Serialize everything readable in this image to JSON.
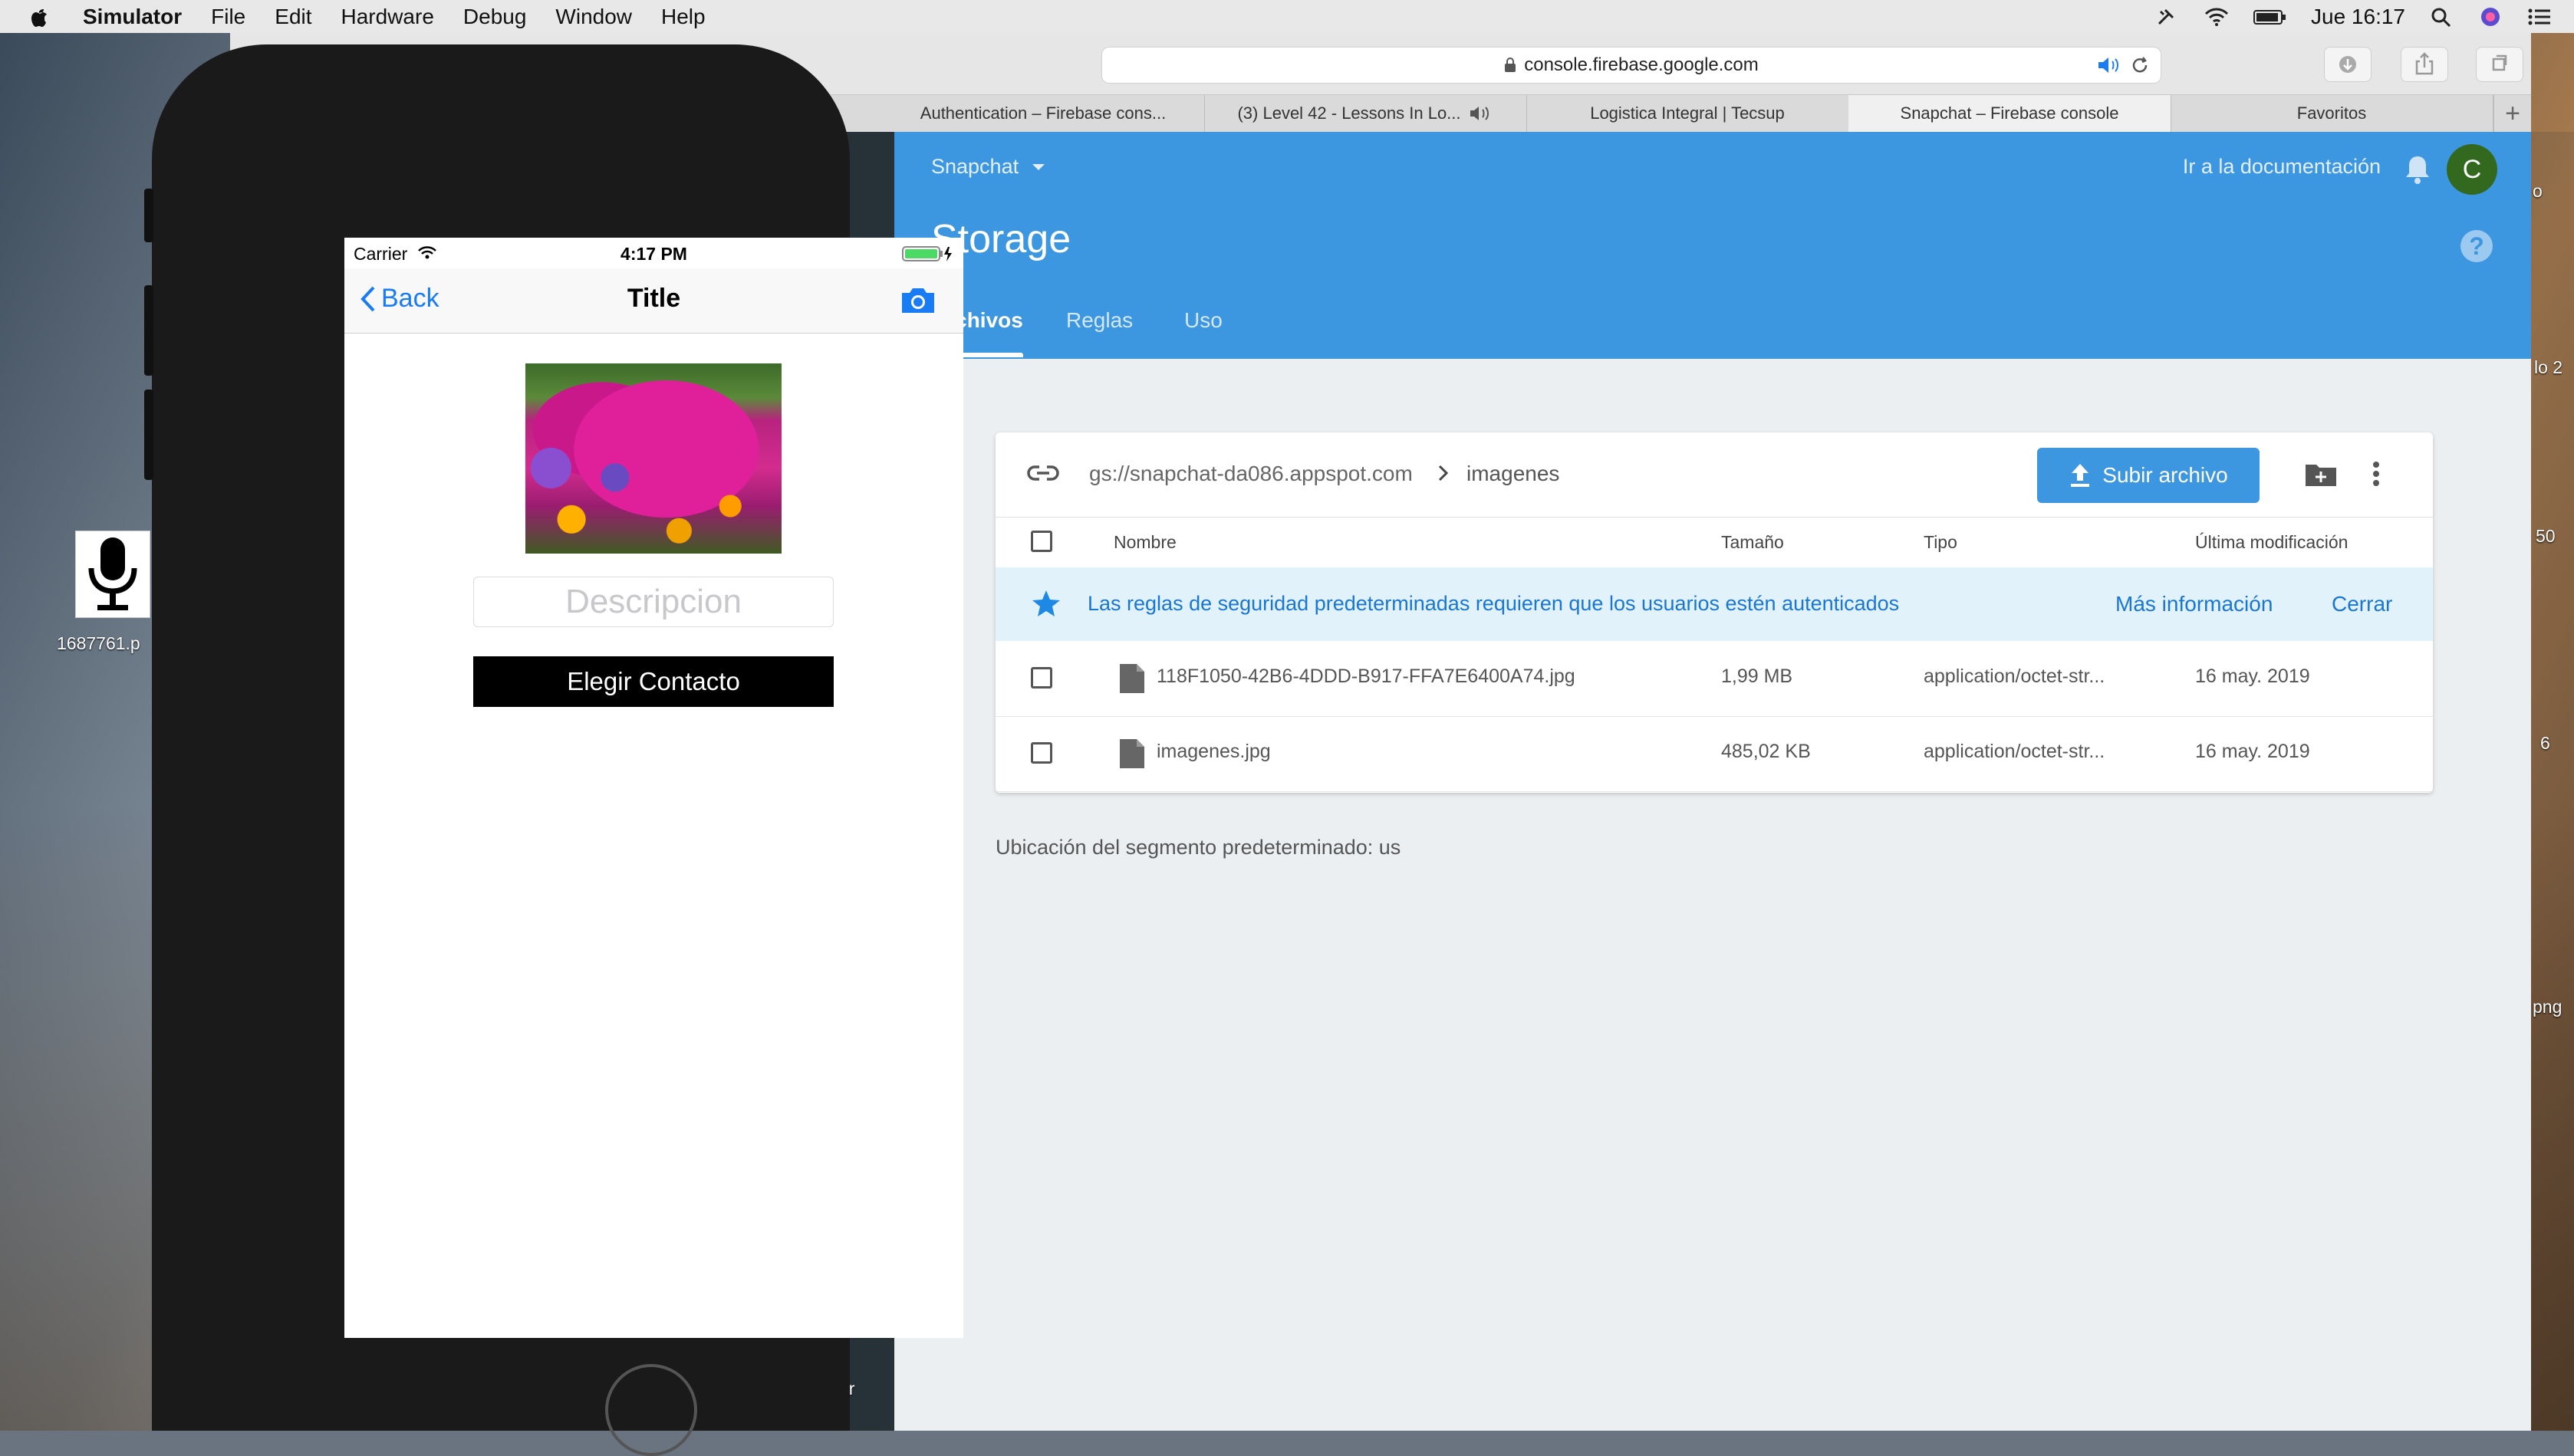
{
  "menubar": {
    "app": "Simulator",
    "items": [
      "File",
      "Edit",
      "Hardware",
      "Debug",
      "Window",
      "Help"
    ],
    "clock": "Jue 16:17"
  },
  "browser": {
    "url": "console.firebase.google.com",
    "tabs": [
      {
        "label": "Authentication – Firebase cons..."
      },
      {
        "label": "(3) Level 42 - Lessons In Lo..."
      },
      {
        "label": "Logistica Integral | Tecsup"
      },
      {
        "label": "Snapchat – Firebase console"
      },
      {
        "label": "Favoritos"
      }
    ]
  },
  "firebase": {
    "project": "Snapchat",
    "docs_link": "Ir a la documentación",
    "avatar_letter": "C",
    "page_title": "Storage",
    "nav_tabs": [
      "Archivos",
      "Reglas",
      "Uso"
    ],
    "bucket_path": "gs://snapchat-da086.appspot.com",
    "folder": "imagenes",
    "upload_label": "Subir archivo",
    "columns": [
      "Nombre",
      "Tamaño",
      "Tipo",
      "Última modificación"
    ],
    "notice": {
      "text": "Las reglas de seguridad predeterminadas requieren que los usuarios estén autenticados",
      "more": "Más información",
      "close": "Cerrar"
    },
    "files": [
      {
        "name": "118F1050-42B6-4DDD-B917-FFA7E6400A74.jpg",
        "size": "1,99 MB",
        "type": "application/octet-str...",
        "modified": "16 may. 2019"
      },
      {
        "name": "imagenes.jpg",
        "size": "485,02 KB",
        "type": "application/octet-str...",
        "modified": "16 may. 2019"
      }
    ],
    "footer": "Ubicación del segmento predeterminado: us",
    "accent": "#3c97e0"
  },
  "simulator": {
    "carrier": "Carrier",
    "time": "4:17 PM",
    "nav_back": "Back",
    "nav_title": "Title",
    "description_placeholder": "Descripcion",
    "contact_button": "Elegir Contacto"
  },
  "desktop": {
    "icon_label": "1687761.p",
    "edge_labels": [
      "lo 2",
      "50",
      "6",
      "png",
      "er",
      "o"
    ]
  }
}
